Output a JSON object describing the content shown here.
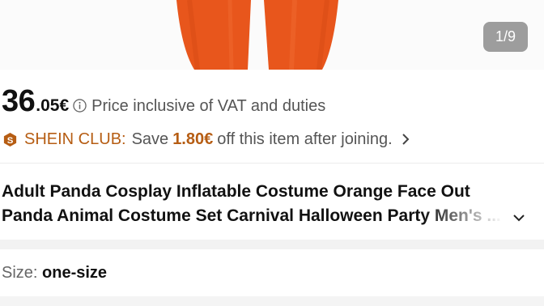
{
  "gallery": {
    "counter": "1/9"
  },
  "price": {
    "integer": "36",
    "decimal": ".05€",
    "note": "Price inclusive of VAT and duties"
  },
  "club": {
    "name": "SHEIN CLUB:",
    "save": "Save",
    "amount": "1.80€",
    "rest": "off this item after joining.",
    "accent_color": "#b65d13"
  },
  "product": {
    "title_line1": "Adult Panda Cosplay Inflatable Costume Orange Face Out",
    "title_line2": "Panda Animal Costume Set Carnival Halloween Party Men's ..."
  },
  "size": {
    "label": "Size:",
    "value": "one-size"
  },
  "icons": {
    "info": "info-icon",
    "club_badge": "shein-club-badge-icon",
    "chevron_right": "chevron-right-icon",
    "chevron_down": "chevron-down-icon"
  }
}
